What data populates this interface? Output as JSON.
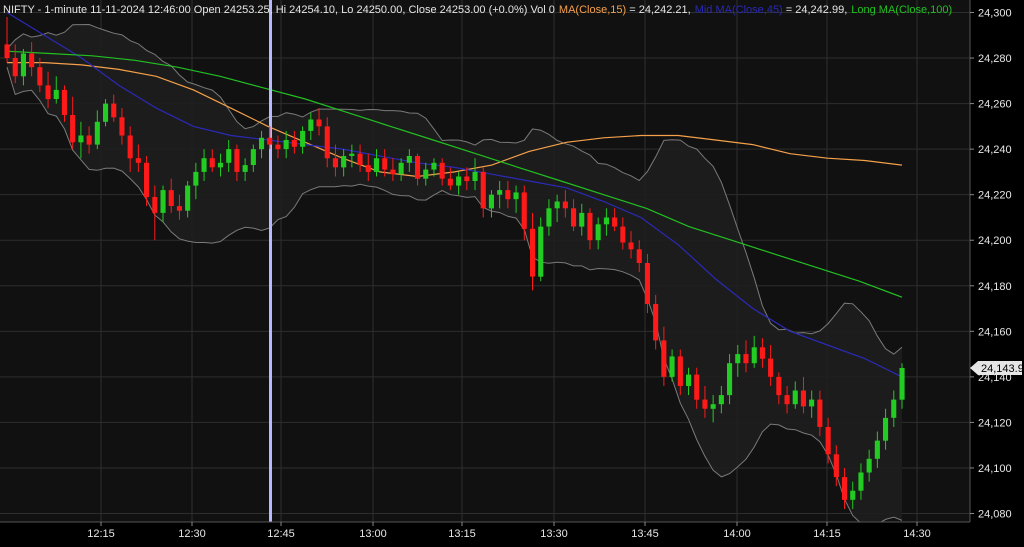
{
  "header": {
    "symbol_info": "NIFTY - 1-minute 11-11-2024 12:46:00 Open 24253.25, Hi 24254.10, Lo 24250.00, Close 24253.00 (+0.0%) Vol 0",
    "ma15_label": "MA(Close,15)",
    "ma15_value": " = 24,242.21,",
    "ma45_label": "Mid MA(Close,45)",
    "ma45_value": " = 24,242.99,",
    "ma100_label": "Long MA(Close,100)"
  },
  "colors": {
    "background": "#000000",
    "plot_background": "#111111",
    "grid": "#2e2e2e",
    "up_candle": "#22cc22",
    "down_candle": "#ff1a1a",
    "ma15": "#f5a04a",
    "ma45": "#2a2ab8",
    "ma100": "#22c022",
    "bands": "#7a7a7a",
    "cursor": "#b9b9ff",
    "text": "#e6e6e6"
  },
  "chart_data": {
    "type": "candlestick",
    "ylim": [
      24075,
      24305
    ],
    "y_ticks": [
      "24,080",
      "24,100",
      "24,120",
      "24,140",
      "24,160",
      "24,180",
      "24,200",
      "24,220",
      "24,240",
      "24,260",
      "24,280",
      "24,300"
    ],
    "x_ticks": [
      "12:15",
      "12:30",
      "12:45",
      "13:00",
      "13:15",
      "13:30",
      "13:45",
      "14:00",
      "14:15",
      "14:30"
    ],
    "last_price_label": "24,143.9",
    "last_price": 24143.9,
    "cursor_time": "12:46",
    "grid": true,
    "candles": [
      [
        24286,
        24298,
        24278,
        24280
      ],
      [
        24280,
        24286,
        24269,
        24272
      ],
      [
        24272,
        24284,
        24268,
        24282
      ],
      [
        24282,
        24287,
        24272,
        24276
      ],
      [
        24276,
        24280,
        24265,
        24268
      ],
      [
        24268,
        24274,
        24258,
        24262
      ],
      [
        24262,
        24272,
        24260,
        24266
      ],
      [
        24266,
        24268,
        24252,
        24255
      ],
      [
        24255,
        24263,
        24240,
        24243
      ],
      [
        24243,
        24252,
        24236,
        24246
      ],
      [
        24246,
        24250,
        24238,
        24242
      ],
      [
        24242,
        24257,
        24240,
        24252
      ],
      [
        24252,
        24262,
        24250,
        24260
      ],
      [
        24260,
        24264,
        24252,
        24254
      ],
      [
        24254,
        24258,
        24242,
        24246
      ],
      [
        24246,
        24250,
        24230,
        24236
      ],
      [
        24236,
        24242,
        24230,
        24234
      ],
      [
        24234,
        24237,
        24215,
        24219
      ],
      [
        24219,
        24224,
        24200,
        24212
      ],
      [
        24212,
        24224,
        24208,
        24222
      ],
      [
        24222,
        24227,
        24212,
        24215
      ],
      [
        24215,
        24220,
        24209,
        24213
      ],
      [
        24213,
        24226,
        24210,
        24224
      ],
      [
        24224,
        24234,
        24218,
        24230
      ],
      [
        24230,
        24240,
        24226,
        24236
      ],
      [
        24236,
        24240,
        24230,
        24232
      ],
      [
        24232,
        24238,
        24228,
        24234
      ],
      [
        24234,
        24244,
        24230,
        24240
      ],
      [
        24240,
        24242,
        24226,
        24230
      ],
      [
        24230,
        24236,
        24226,
        24233
      ],
      [
        24233,
        24242,
        24230,
        24240
      ],
      [
        24240,
        24248,
        24236,
        24245
      ],
      [
        24245,
        24250,
        24240,
        24242
      ],
      [
        24242,
        24246,
        24236,
        24240
      ],
      [
        24240,
        24248,
        24236,
        24244
      ],
      [
        24244,
        24248,
        24238,
        24241
      ],
      [
        24241,
        24250,
        24238,
        24248
      ],
      [
        24248,
        24256,
        24244,
        24253
      ],
      [
        24253,
        24258,
        24246,
        24250
      ],
      [
        24250,
        24254,
        24232,
        24236
      ],
      [
        24236,
        24242,
        24228,
        24232
      ],
      [
        24232,
        24240,
        24228,
        24237
      ],
      [
        24237,
        24242,
        24232,
        24238
      ],
      [
        24238,
        24242,
        24230,
        24233
      ],
      [
        24233,
        24238,
        24226,
        24230
      ],
      [
        24230,
        24240,
        24228,
        24236
      ],
      [
        24236,
        24240,
        24228,
        24231
      ],
      [
        24231,
        24236,
        24226,
        24229
      ],
      [
        24229,
        24236,
        24226,
        24234
      ],
      [
        24234,
        24240,
        24230,
        24237
      ],
      [
        24237,
        24238,
        24224,
        24227
      ],
      [
        24227,
        24234,
        24224,
        24231
      ],
      [
        24231,
        24236,
        24228,
        24234
      ],
      [
        24234,
        24236,
        24224,
        24227
      ],
      [
        24227,
        24232,
        24222,
        24224
      ],
      [
        24224,
        24230,
        24220,
        24228
      ],
      [
        24228,
        24232,
        24222,
        24226
      ],
      [
        24226,
        24236,
        24222,
        24230
      ],
      [
        24230,
        24232,
        24210,
        24214
      ],
      [
        24214,
        24222,
        24210,
        24220
      ],
      [
        24220,
        24226,
        24214,
        24222
      ],
      [
        24222,
        24226,
        24214,
        24218
      ],
      [
        24218,
        24224,
        24212,
        24221
      ],
      [
        24221,
        24224,
        24200,
        24205
      ],
      [
        24205,
        24212,
        24178,
        24184
      ],
      [
        24184,
        24210,
        24182,
        24206
      ],
      [
        24206,
        24218,
        24202,
        24214
      ],
      [
        24214,
        24220,
        24208,
        24217
      ],
      [
        24217,
        24222,
        24210,
        24214
      ],
      [
        24214,
        24218,
        24204,
        24206
      ],
      [
        24206,
        24216,
        24202,
        24212
      ],
      [
        24212,
        24214,
        24196,
        24200
      ],
      [
        24200,
        24210,
        24196,
        24207
      ],
      [
        24207,
        24214,
        24202,
        24210
      ],
      [
        24210,
        24214,
        24204,
        24206
      ],
      [
        24206,
        24210,
        24196,
        24199
      ],
      [
        24199,
        24204,
        24192,
        24196
      ],
      [
        24196,
        24200,
        24186,
        24190
      ],
      [
        24190,
        24194,
        24168,
        24172
      ],
      [
        24172,
        24176,
        24152,
        24156
      ],
      [
        24156,
        24162,
        24136,
        24140
      ],
      [
        24140,
        24152,
        24138,
        24149
      ],
      [
        24149,
        24152,
        24132,
        24136
      ],
      [
        24136,
        24144,
        24132,
        24141
      ],
      [
        24141,
        24144,
        24126,
        24130
      ],
      [
        24130,
        24136,
        24122,
        24126
      ],
      [
        24126,
        24132,
        24120,
        24128
      ],
      [
        24128,
        24136,
        24124,
        24132
      ],
      [
        24132,
        24150,
        24128,
        24146
      ],
      [
        24146,
        24154,
        24140,
        24150
      ],
      [
        24150,
        24156,
        24142,
        24146
      ],
      [
        24146,
        24158,
        24144,
        24153
      ],
      [
        24153,
        24157,
        24144,
        24148
      ],
      [
        24148,
        24154,
        24136,
        24140
      ],
      [
        24140,
        24142,
        24128,
        24132
      ],
      [
        24132,
        24136,
        24124,
        24128
      ],
      [
        24128,
        24138,
        24126,
        24134
      ],
      [
        24134,
        24140,
        24124,
        24127
      ],
      [
        24127,
        24134,
        24122,
        24130
      ],
      [
        24130,
        24134,
        24114,
        24118
      ],
      [
        24118,
        24122,
        24102,
        24106
      ],
      [
        24106,
        24110,
        24092,
        24096
      ],
      [
        24096,
        24100,
        24082,
        24086
      ],
      [
        24086,
        24094,
        24082,
        24090
      ],
      [
        24090,
        24102,
        24086,
        24098
      ],
      [
        24098,
        24108,
        24094,
        24104
      ],
      [
        24104,
        24116,
        24100,
        24112
      ],
      [
        24112,
        24126,
        24108,
        24122
      ],
      [
        24122,
        24134,
        24118,
        24130
      ],
      [
        24130,
        24146,
        24126,
        24143.9
      ]
    ],
    "series": [
      {
        "name": "MA(Close,15)",
        "values": [
          24278,
          24278,
          24277,
          24275,
          24272,
          24266,
          24258,
          24250,
          24243,
          24236,
          24230,
          24228,
          24230,
          24233,
          24239,
          24243,
          24245,
          24246,
          24246,
          24244,
          24242,
          24238,
          24236,
          24235,
          24233
        ]
      },
      {
        "name": "Mid MA(Close,45)",
        "values": [
          24300,
          24290,
          24280,
          24268,
          24258,
          24250,
          24246,
          24244,
          24242,
          24240,
          24237,
          24234,
          24232,
          24229,
          24226,
          24223,
          24217,
          24210,
          24198,
          24183,
          24170,
          24160,
          24154,
          24148,
          24140
        ]
      },
      {
        "name": "Long MA(Close,100)",
        "values": [
          24283,
          24282,
          24281,
          24279,
          24276,
          24272,
          24267,
          24262,
          24256,
          24250,
          24244,
          24238,
          24232,
          24226,
          24220,
          24214,
          24206,
          24200,
          24194,
          24188,
          24182,
          24175
        ]
      }
    ]
  }
}
